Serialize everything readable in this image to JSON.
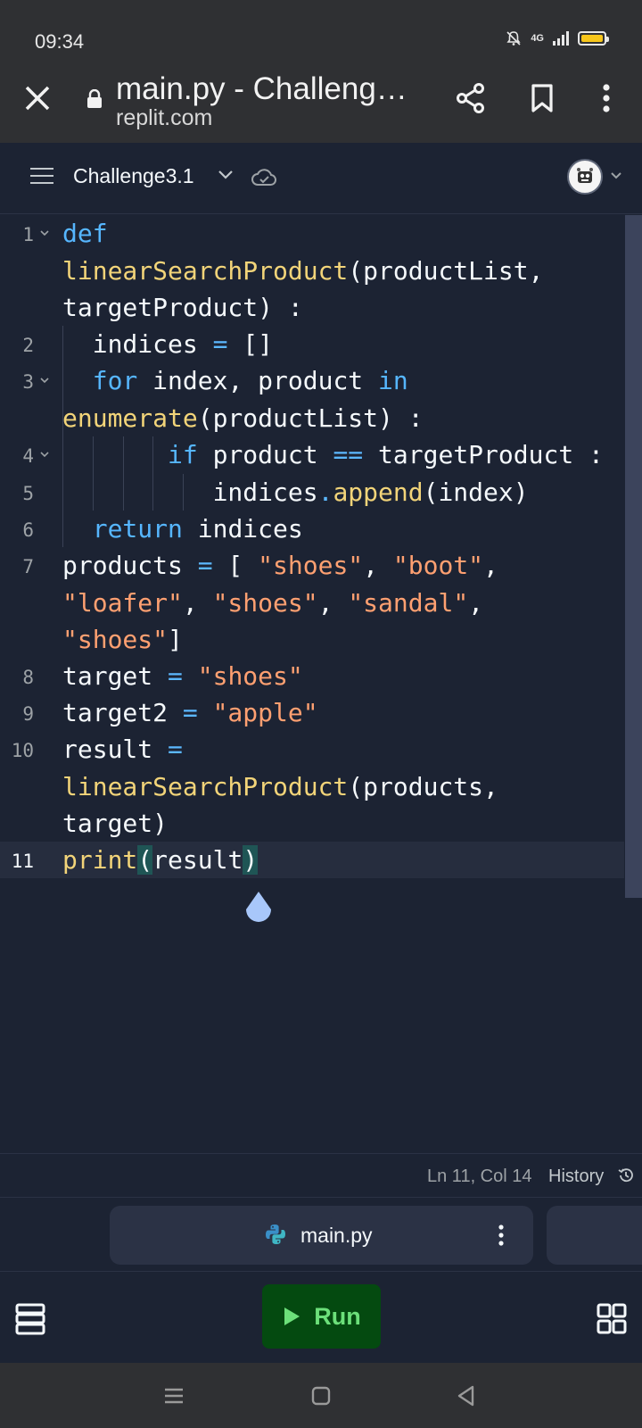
{
  "status_bar": {
    "time": "09:34",
    "network": "4G",
    "battery_color": "#f7c61b"
  },
  "browser": {
    "page_title": "main.py - Challeng…",
    "domain": "replit.com"
  },
  "header": {
    "project_name": "Challenge3.1"
  },
  "editor": {
    "line_numbers": [
      "1",
      "2",
      "3",
      "4",
      "5",
      "6",
      "7",
      "8",
      "9",
      "10",
      "11"
    ],
    "active_line": "11"
  },
  "status_strip": {
    "cursor_position": "Ln 11, Col 14",
    "history_label": "History"
  },
  "file_tab": {
    "name": "main.py"
  },
  "bottom_bar": {
    "run_label": "Run"
  },
  "colors": {
    "background": "#1c2333",
    "keyword": "#56b6ff",
    "function": "#f2d479",
    "string": "#ffa071",
    "run_button": "#044a10",
    "run_text": "#6ce07a"
  }
}
